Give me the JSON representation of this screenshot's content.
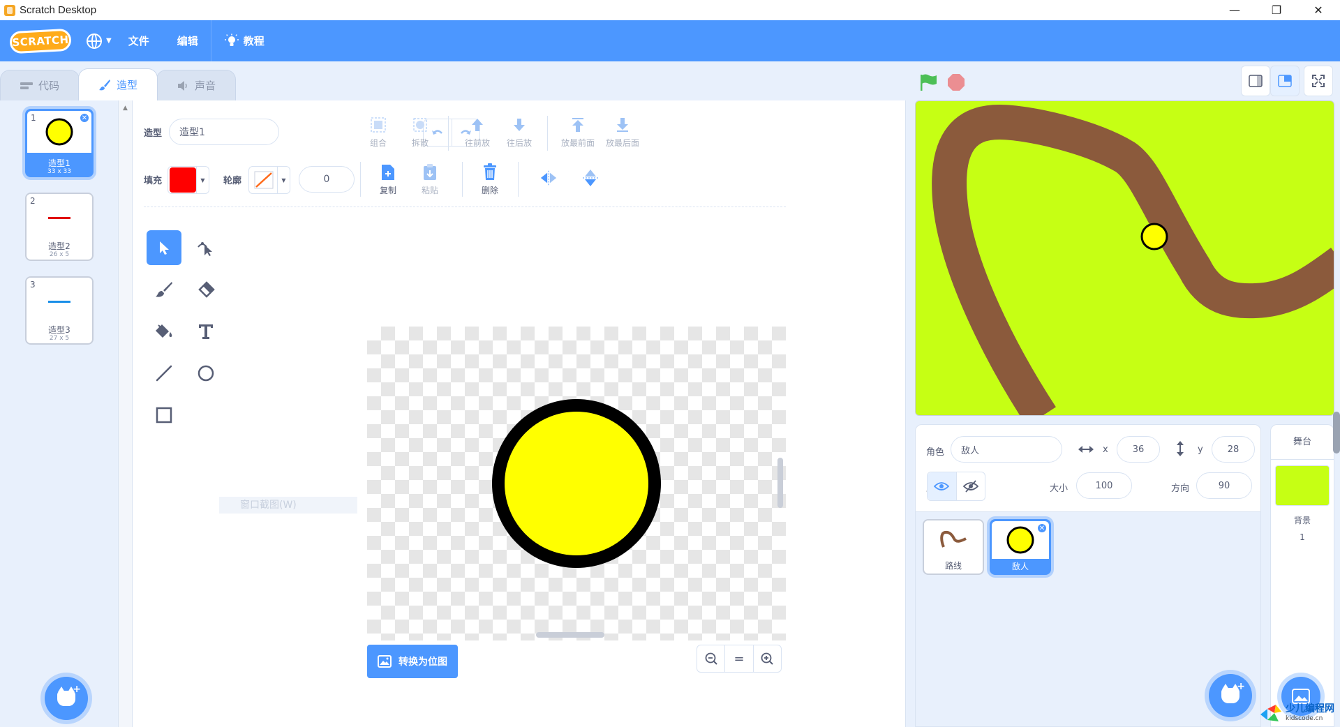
{
  "window": {
    "title": "Scratch Desktop",
    "controls": [
      "—",
      "❐",
      "✕"
    ]
  },
  "menubar": {
    "logo": "SCRATCH",
    "file": "文件",
    "edit": "编辑",
    "tutorials": "教程"
  },
  "tabs": [
    {
      "label": "代码",
      "active": false
    },
    {
      "label": "造型",
      "active": true
    },
    {
      "label": "声音",
      "active": false
    }
  ],
  "costumes": [
    {
      "number": "1",
      "name": "造型1",
      "size": "33 x 33",
      "selected": true
    },
    {
      "number": "2",
      "name": "造型2",
      "size": "26 x 5",
      "selected": false
    },
    {
      "number": "3",
      "name": "造型3",
      "size": "27 x 5",
      "selected": false
    }
  ],
  "editor": {
    "costume_label": "造型",
    "costume_name": "造型1",
    "fill_label": "填充",
    "outline_label": "轮廓",
    "outline_width": "0",
    "fill_color": "#ff0000",
    "buttons": {
      "group": "组合",
      "ungroup": "拆散",
      "forward": "往前放",
      "backward": "往后放",
      "front": "放最前面",
      "back": "放最后面",
      "copy": "复制",
      "paste": "粘贴",
      "delete": "删除"
    },
    "convert_button": "转换为位图",
    "zoom_reset": "=",
    "ghost_tooltip": "窗口截图(W)"
  },
  "sprite_info": {
    "sprite_label": "角色",
    "sprite_name": "敌人",
    "x_label": "x",
    "x_value": "36",
    "y_label": "y",
    "y_value": "28",
    "show_label": "显示",
    "size_label": "大小",
    "size_value": "100",
    "direction_label": "方向",
    "direction_value": "90"
  },
  "sprites": [
    {
      "name": "路线",
      "selected": false
    },
    {
      "name": "敌人",
      "selected": true
    }
  ],
  "stage_panel": {
    "header": "舞台",
    "backdrops_label": "背景",
    "backdrops_count": "1"
  },
  "watermark": {
    "cn": "少儿编程网",
    "en": "kidscode.cn"
  },
  "colors": {
    "accent": "#4c97ff",
    "stage_bg": "#c6ff14",
    "path": "#8b5a3c",
    "enemy": "#ffff00"
  }
}
